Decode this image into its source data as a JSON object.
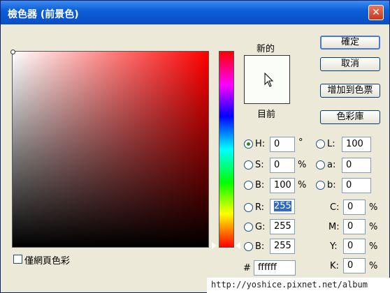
{
  "window": {
    "title": "檢色器 (前景色)",
    "close_glyph": "✕"
  },
  "preview": {
    "new_label": "新的",
    "current_label": "目前",
    "color": "#ffffff"
  },
  "buttons": {
    "ok": "確定",
    "cancel": "取消",
    "add_swatch": "增加到色票",
    "libraries": "色彩庫"
  },
  "hsb": {
    "h_label": "H:",
    "h_value": "0",
    "h_unit": "°",
    "s_label": "S:",
    "s_value": "0",
    "s_unit": "%",
    "b_label": "B:",
    "b_value": "100",
    "b_unit": "%"
  },
  "lab": {
    "l_label": "L:",
    "l_value": "100",
    "a_label": "a:",
    "a_value": "0",
    "b_label": "b:",
    "b_value": "0"
  },
  "rgb": {
    "r_label": "R:",
    "r_value": "255",
    "g_label": "G:",
    "g_value": "255",
    "b_label": "B:",
    "b_value": "255"
  },
  "cmyk": {
    "c_label": "C:",
    "c_value": "0",
    "m_label": "M:",
    "m_value": "0",
    "y_label": "Y:",
    "y_value": "0",
    "k_label": "K:",
    "k_value": "0",
    "unit": "%"
  },
  "hex": {
    "label": "#",
    "value": "ffffff"
  },
  "web_only": {
    "label": "僅網頁色彩",
    "checked": false
  },
  "watermark": "http://yoshice.pixnet.net/album"
}
